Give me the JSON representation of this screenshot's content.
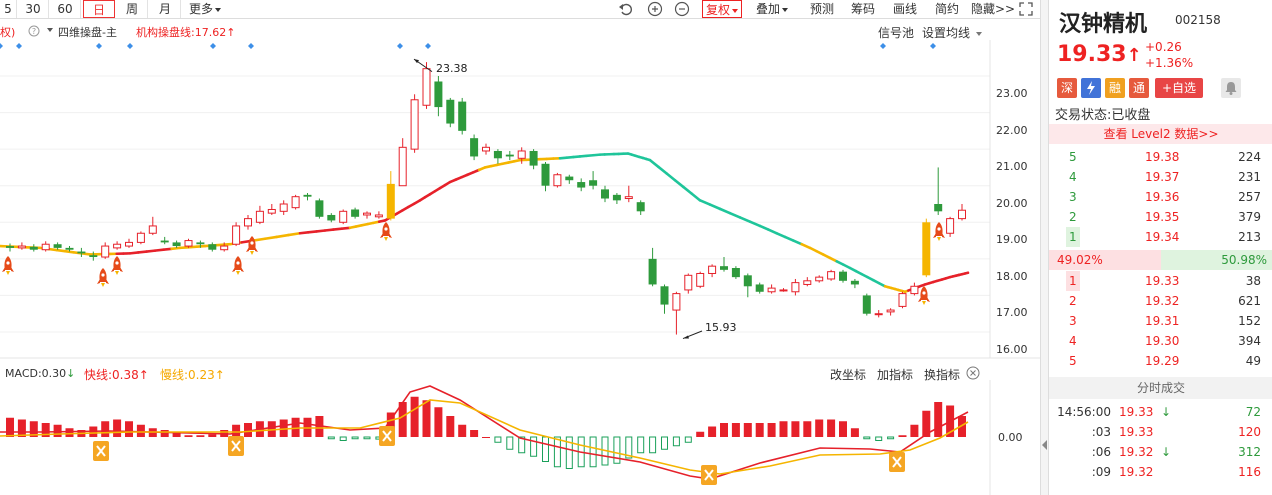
{
  "toolbar": {
    "periods": [
      "5",
      "30",
      "60",
      "日",
      "周",
      "月"
    ],
    "more": "更多",
    "right_buttons": [
      "复权",
      "叠加",
      "预测",
      "筹码",
      "画线",
      "简约",
      "隐藏>>"
    ]
  },
  "main_chart": {
    "left_tag": "权)",
    "indicator_name": "四维操盘-主",
    "indicator_value": "机构操盘线:17.62",
    "signal_pool": "信号池",
    "set_ma": "设置均线",
    "price_axis": [
      "23.00",
      "22.00",
      "21.00",
      "20.00",
      "19.00",
      "18.00",
      "17.00",
      "16.00"
    ],
    "high_label": "23.38",
    "low_label": "15.93"
  },
  "macd": {
    "label": "MACD:0.30",
    "fast": "快线:0.38",
    "slow": "慢线:0.23",
    "zero": "0.00",
    "buttons": [
      "改坐标",
      "加指标",
      "换指标"
    ]
  },
  "chart_data": {
    "type": "candlestick",
    "y_axis_ticks": [
      23.0,
      22.0,
      21.0,
      20.0,
      19.0,
      18.0,
      17.0,
      16.0
    ],
    "ylim": [
      15.7,
      23.6
    ],
    "candles": [
      {
        "o": 18.35,
        "c": 18.3,
        "h": 18.42,
        "l": 18.2
      },
      {
        "o": 18.3,
        "c": 18.35,
        "h": 18.45,
        "l": 18.25
      },
      {
        "o": 18.33,
        "c": 18.25,
        "h": 18.4,
        "l": 18.2
      },
      {
        "o": 18.25,
        "c": 18.4,
        "h": 18.48,
        "l": 18.2
      },
      {
        "o": 18.4,
        "c": 18.3,
        "h": 18.45,
        "l": 18.25
      },
      {
        "o": 18.3,
        "c": 18.25,
        "h": 18.35,
        "l": 18.2
      },
      {
        "o": 18.2,
        "c": 18.15,
        "h": 18.3,
        "l": 18.05
      },
      {
        "o": 18.1,
        "c": 18.05,
        "h": 18.2,
        "l": 17.95
      },
      {
        "o": 18.05,
        "c": 18.35,
        "h": 18.45,
        "l": 18.0
      },
      {
        "o": 18.3,
        "c": 18.4,
        "h": 18.48,
        "l": 18.25
      },
      {
        "o": 18.35,
        "c": 18.45,
        "h": 18.55,
        "l": 18.3
      },
      {
        "o": 18.45,
        "c": 18.7,
        "h": 18.75,
        "l": 18.4
      },
      {
        "o": 18.7,
        "c": 18.9,
        "h": 19.15,
        "l": 18.65
      },
      {
        "o": 18.5,
        "c": 18.45,
        "h": 18.6,
        "l": 18.4
      },
      {
        "o": 18.45,
        "c": 18.35,
        "h": 18.5,
        "l": 18.3
      },
      {
        "o": 18.35,
        "c": 18.5,
        "h": 18.55,
        "l": 18.3
      },
      {
        "o": 18.45,
        "c": 18.4,
        "h": 18.5,
        "l": 18.3
      },
      {
        "o": 18.4,
        "c": 18.25,
        "h": 18.45,
        "l": 18.2
      },
      {
        "o": 18.25,
        "c": 18.35,
        "h": 18.45,
        "l": 18.2
      },
      {
        "o": 18.4,
        "c": 18.9,
        "h": 19.0,
        "l": 18.35
      },
      {
        "o": 18.9,
        "c": 19.1,
        "h": 19.2,
        "l": 18.8
      },
      {
        "o": 19.0,
        "c": 19.3,
        "h": 19.45,
        "l": 18.95
      },
      {
        "o": 19.25,
        "c": 19.35,
        "h": 19.5,
        "l": 19.2
      },
      {
        "o": 19.3,
        "c": 19.5,
        "h": 19.6,
        "l": 19.2
      },
      {
        "o": 19.4,
        "c": 19.7,
        "h": 19.75,
        "l": 19.35
      },
      {
        "o": 19.75,
        "c": 19.7,
        "h": 19.8,
        "l": 19.6
      },
      {
        "o": 19.6,
        "c": 19.15,
        "h": 19.65,
        "l": 19.1
      },
      {
        "o": 19.2,
        "c": 19.05,
        "h": 19.25,
        "l": 19.0
      },
      {
        "o": 19.0,
        "c": 19.3,
        "h": 19.35,
        "l": 18.95
      },
      {
        "o": 19.35,
        "c": 19.15,
        "h": 19.4,
        "l": 19.1
      },
      {
        "o": 19.2,
        "c": 19.25,
        "h": 19.3,
        "l": 19.1
      },
      {
        "o": 19.15,
        "c": 19.2,
        "h": 19.3,
        "l": 19.1
      },
      {
        "o": 19.1,
        "c": 20.05,
        "h": 20.4,
        "l": 19.05
      },
      {
        "o": 20.0,
        "c": 21.05,
        "h": 21.3,
        "l": 20.0
      },
      {
        "o": 21.0,
        "c": 22.35,
        "h": 22.5,
        "l": 20.9
      },
      {
        "o": 22.2,
        "c": 23.2,
        "h": 23.38,
        "l": 22.1
      },
      {
        "o": 22.85,
        "c": 22.15,
        "h": 23.0,
        "l": 21.9
      },
      {
        "o": 22.35,
        "c": 21.7,
        "h": 22.4,
        "l": 21.6
      },
      {
        "o": 22.3,
        "c": 21.5,
        "h": 22.4,
        "l": 21.4
      },
      {
        "o": 21.3,
        "c": 20.8,
        "h": 21.4,
        "l": 20.7
      },
      {
        "o": 20.95,
        "c": 21.05,
        "h": 21.15,
        "l": 20.85
      },
      {
        "o": 20.95,
        "c": 20.75,
        "h": 21.0,
        "l": 20.6
      },
      {
        "o": 20.85,
        "c": 20.8,
        "h": 20.95,
        "l": 20.7
      },
      {
        "o": 20.75,
        "c": 20.95,
        "h": 21.05,
        "l": 20.6
      },
      {
        "o": 20.95,
        "c": 20.55,
        "h": 21.0,
        "l": 20.45
      },
      {
        "o": 20.6,
        "c": 20.0,
        "h": 20.65,
        "l": 19.85
      },
      {
        "o": 20.0,
        "c": 20.3,
        "h": 20.35,
        "l": 19.95
      },
      {
        "o": 20.25,
        "c": 20.15,
        "h": 20.3,
        "l": 20.05
      },
      {
        "o": 20.1,
        "c": 19.95,
        "h": 20.2,
        "l": 19.85
      },
      {
        "o": 20.15,
        "c": 20.0,
        "h": 20.4,
        "l": 19.9
      },
      {
        "o": 19.9,
        "c": 19.65,
        "h": 20.0,
        "l": 19.55
      },
      {
        "o": 19.75,
        "c": 19.6,
        "h": 19.8,
        "l": 19.5
      },
      {
        "o": 19.65,
        "c": 19.7,
        "h": 20.0,
        "l": 19.55
      },
      {
        "o": 19.55,
        "c": 19.3,
        "h": 19.6,
        "l": 19.2
      },
      {
        "o": 18.0,
        "c": 17.3,
        "h": 18.3,
        "l": 17.25
      },
      {
        "o": 17.25,
        "c": 16.75,
        "h": 17.3,
        "l": 16.5
      },
      {
        "o": 16.6,
        "c": 17.05,
        "h": 17.1,
        "l": 15.93
      },
      {
        "o": 17.15,
        "c": 17.55,
        "h": 17.6,
        "l": 17.05
      },
      {
        "o": 17.25,
        "c": 17.6,
        "h": 17.65,
        "l": 17.2
      },
      {
        "o": 17.6,
        "c": 17.8,
        "h": 17.85,
        "l": 17.5
      },
      {
        "o": 17.8,
        "c": 17.7,
        "h": 18.05,
        "l": 17.65
      },
      {
        "o": 17.75,
        "c": 17.5,
        "h": 17.8,
        "l": 17.45
      },
      {
        "o": 17.55,
        "c": 17.25,
        "h": 17.6,
        "l": 16.95
      },
      {
        "o": 17.3,
        "c": 17.1,
        "h": 17.35,
        "l": 17.05
      },
      {
        "o": 17.1,
        "c": 17.2,
        "h": 17.3,
        "l": 17.05
      },
      {
        "o": 17.15,
        "c": 17.15,
        "h": 17.2,
        "l": 17.1
      },
      {
        "o": 17.1,
        "c": 17.35,
        "h": 17.45,
        "l": 17.0
      },
      {
        "o": 17.3,
        "c": 17.4,
        "h": 17.5,
        "l": 17.25
      },
      {
        "o": 17.4,
        "c": 17.5,
        "h": 17.55,
        "l": 17.35
      },
      {
        "o": 17.45,
        "c": 17.65,
        "h": 17.7,
        "l": 17.4
      },
      {
        "o": 17.65,
        "c": 17.4,
        "h": 17.7,
        "l": 17.35
      },
      {
        "o": 17.4,
        "c": 17.3,
        "h": 17.45,
        "l": 17.2
      },
      {
        "o": 17.0,
        "c": 16.5,
        "h": 17.05,
        "l": 16.45
      },
      {
        "o": 16.5,
        "c": 16.5,
        "h": 16.6,
        "l": 16.4
      },
      {
        "o": 16.55,
        "c": 16.6,
        "h": 16.65,
        "l": 16.45
      },
      {
        "o": 16.7,
        "c": 17.05,
        "h": 17.1,
        "l": 16.65
      },
      {
        "o": 17.05,
        "c": 17.25,
        "h": 17.35,
        "l": 17.0
      },
      {
        "o": 17.55,
        "c": 19.0,
        "h": 19.1,
        "l": 17.5
      },
      {
        "o": 19.5,
        "c": 19.3,
        "h": 20.5,
        "l": 19.2
      },
      {
        "o": 18.7,
        "c": 19.1,
        "h": 19.15,
        "l": 18.6
      },
      {
        "o": 19.1,
        "c": 19.33,
        "h": 19.5,
        "l": 19.05
      }
    ]
  },
  "stock": {
    "name": "汉钟精机",
    "code": "002158",
    "price": "19.33",
    "arrow": "↑",
    "change": "+0.26",
    "change_pct": "+1.36%",
    "badges": [
      "深",
      "融",
      "通",
      "+自选"
    ],
    "status_label": "交易状态:",
    "status": "已收盘",
    "level2": "查看 Level2 数据>>"
  },
  "orderbook": {
    "asks": [
      {
        "lvl": "5",
        "price": "19.38",
        "vol": "224"
      },
      {
        "lvl": "4",
        "price": "19.37",
        "vol": "231"
      },
      {
        "lvl": "3",
        "price": "19.36",
        "vol": "257"
      },
      {
        "lvl": "2",
        "price": "19.35",
        "vol": "379"
      },
      {
        "lvl": "1",
        "price": "19.34",
        "vol": "213"
      }
    ],
    "ratio_left": "49.02%",
    "ratio_right": "50.98%",
    "bids": [
      {
        "lvl": "1",
        "price": "19.33",
        "vol": "38"
      },
      {
        "lvl": "2",
        "price": "19.32",
        "vol": "621"
      },
      {
        "lvl": "3",
        "price": "19.31",
        "vol": "152"
      },
      {
        "lvl": "4",
        "price": "19.30",
        "vol": "394"
      },
      {
        "lvl": "5",
        "price": "19.29",
        "vol": "49"
      }
    ]
  },
  "ticks": {
    "title": "分时成交",
    "rows": [
      {
        "time": "14:56:00",
        "price": "19.33",
        "dir": "↓",
        "vol": "72"
      },
      {
        "time": ":03",
        "price": "19.33",
        "dir": "",
        "vol": "120"
      },
      {
        "time": ":06",
        "price": "19.32",
        "dir": "↓",
        "vol": "312"
      },
      {
        "time": ":09",
        "price": "19.32",
        "dir": "",
        "vol": "116"
      }
    ]
  },
  "colors": {
    "up": "#e6212a",
    "down": "#2e9a3c",
    "yellow": "#f5b500",
    "teal": "#1fc59a"
  }
}
